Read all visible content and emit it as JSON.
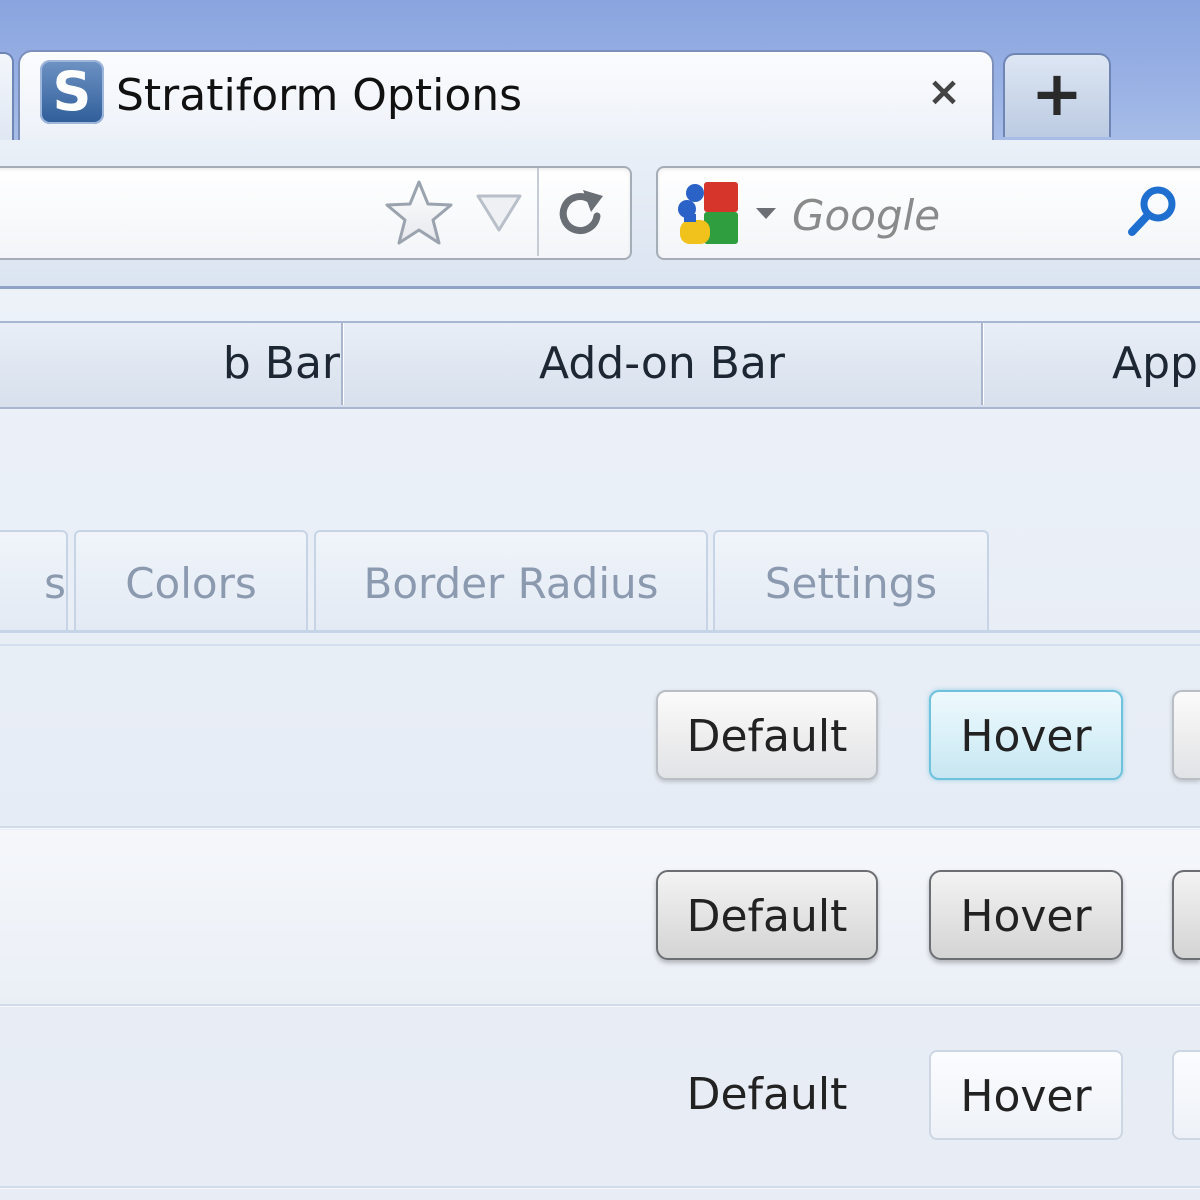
{
  "tab": {
    "title": "Stratiform Options",
    "favicon_letter": "S",
    "close_label": "×",
    "new_tab_label": "+"
  },
  "navbar": {
    "search_placeholder": "Google"
  },
  "categories": [
    "b Bar",
    "Add-on Bar",
    "App"
  ],
  "subtabs": [
    "s",
    "Colors",
    "Border Radius",
    "Settings"
  ],
  "rows": [
    {
      "default_label": "Default",
      "hover_label": "Hover"
    },
    {
      "default_label": "Default",
      "hover_label": "Hover"
    },
    {
      "default_label": "Default",
      "hover_label": "Hover"
    }
  ],
  "icons": {
    "favicon": "stratiform-s-icon",
    "bookmark": "star-icon",
    "url_dropdown": "triangle-down-icon",
    "reload": "reload-icon",
    "search_engine": "google-icon",
    "search_go": "magnifier-icon"
  },
  "colors": {
    "titlebar": "#8aa4df",
    "hover_accent": "#6fc2dc",
    "search_icon": "#1f6fd0"
  }
}
